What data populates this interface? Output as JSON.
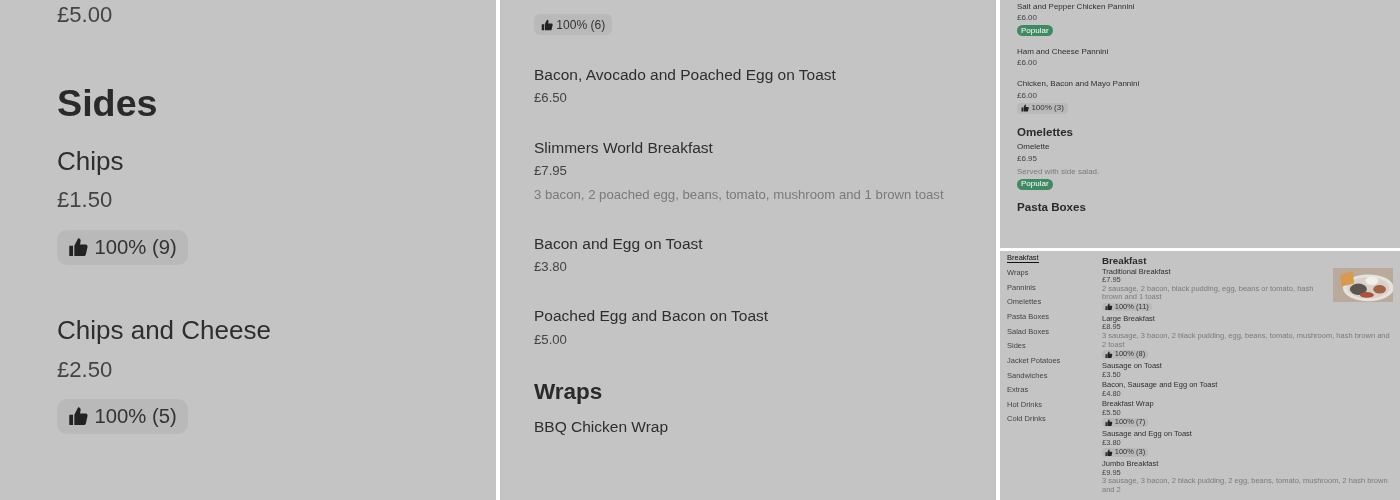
{
  "panels": [
    {
      "kind": "menu",
      "blocks": [
        {
          "kind": "item",
          "price": "£5.00"
        },
        {
          "kind": "heading",
          "text": "Sides"
        },
        {
          "kind": "item",
          "name": "Chips",
          "price": "£1.50",
          "rating": "100% (9)"
        },
        {
          "kind": "item",
          "name": "Chips and Cheese",
          "price": "£2.50",
          "rating": "100% (5)"
        }
      ]
    },
    {
      "kind": "menu",
      "blocks": [
        {
          "kind": "item",
          "rating": "100% (6)"
        },
        {
          "kind": "item",
          "name": "Bacon, Avocado and Poached Egg on Toast",
          "price": "£6.50"
        },
        {
          "kind": "item",
          "name": "Slimmers World Breakfast",
          "price": "£7.95",
          "description": "3 bacon, 2 poached egg, beans, tomato, mushroom and 1 brown toast"
        },
        {
          "kind": "item",
          "name": "Bacon and Egg on Toast",
          "price": "£3.80"
        },
        {
          "kind": "item",
          "name": "Poached Egg and Bacon on Toast",
          "price": "£5.00"
        },
        {
          "kind": "heading",
          "text": "Wraps"
        },
        {
          "kind": "item",
          "name": "BBQ Chicken Wrap"
        }
      ]
    },
    {
      "kind": "menu",
      "blocks": [
        {
          "kind": "item",
          "name": "Salt and Pepper Chicken Pannini",
          "price": "£6.00",
          "badge": "Popular"
        },
        {
          "kind": "item",
          "name": "Ham and Cheese Pannini",
          "price": "£6.00"
        },
        {
          "kind": "item",
          "name": "Chicken, Bacon and Mayo Pannini",
          "price": "£6.00",
          "rating": "100% (3)"
        },
        {
          "kind": "heading",
          "text": "Omelettes"
        },
        {
          "kind": "item",
          "name": "Omelette",
          "price": "£6.95",
          "description": "Served with side salad.",
          "badge": "Popular"
        },
        {
          "kind": "heading",
          "text": "Pasta Boxes"
        }
      ]
    },
    {
      "kind": "menu_with_nav",
      "nav": [
        {
          "label": "Breakfast",
          "selected": true
        },
        {
          "label": "Wraps",
          "selected": false
        },
        {
          "label": "Panninis",
          "selected": false
        },
        {
          "label": "Omelettes",
          "selected": false
        },
        {
          "label": "Pasta Boxes",
          "selected": false
        },
        {
          "label": "Salad Boxes",
          "selected": false
        },
        {
          "label": "Sides",
          "selected": false
        },
        {
          "label": "Jacket Potatoes",
          "selected": false
        },
        {
          "label": "Sandwiches",
          "selected": false
        },
        {
          "label": "Extras",
          "selected": false
        },
        {
          "label": "Hot Drinks",
          "selected": false
        },
        {
          "label": "Cold Drinks",
          "selected": false
        }
      ],
      "blocks": [
        {
          "kind": "heading",
          "text": "Breakfast"
        },
        {
          "kind": "item",
          "name": "Traditional Breakfast",
          "price": "£7.95",
          "description": "2 sausage, 2 bacon, black pudding, egg, beans or tomato, hash brown and 1 toast",
          "rating": "100% (11)"
        },
        {
          "kind": "item",
          "name": "Large Breakfast",
          "price": "£8.95",
          "description": "3 sausage, 3 bacon, 2 black pudding, egg, beans, tomato, mushroom, hash brown and 2 toast",
          "rating": "100% (8)"
        },
        {
          "kind": "item",
          "name": "Sausage on Toast",
          "price": "£3.50"
        },
        {
          "kind": "item",
          "name": "Bacon, Sausage and Egg on Toast",
          "price": "£4.80"
        },
        {
          "kind": "item",
          "name": "Breakfast Wrap",
          "price": "£5.50",
          "rating": "100% (7)"
        },
        {
          "kind": "item",
          "name": "Sausage and Egg on Toast",
          "price": "£3.80",
          "rating": "100% (3)"
        },
        {
          "kind": "item",
          "name": "Jumbo Breakfast",
          "price": "£9.95",
          "description": "3 sausage, 3 bacon, 2 black pudding, 2 egg, beans, tomato, mushroom, 2 hash brown and 2"
        }
      ]
    }
  ]
}
